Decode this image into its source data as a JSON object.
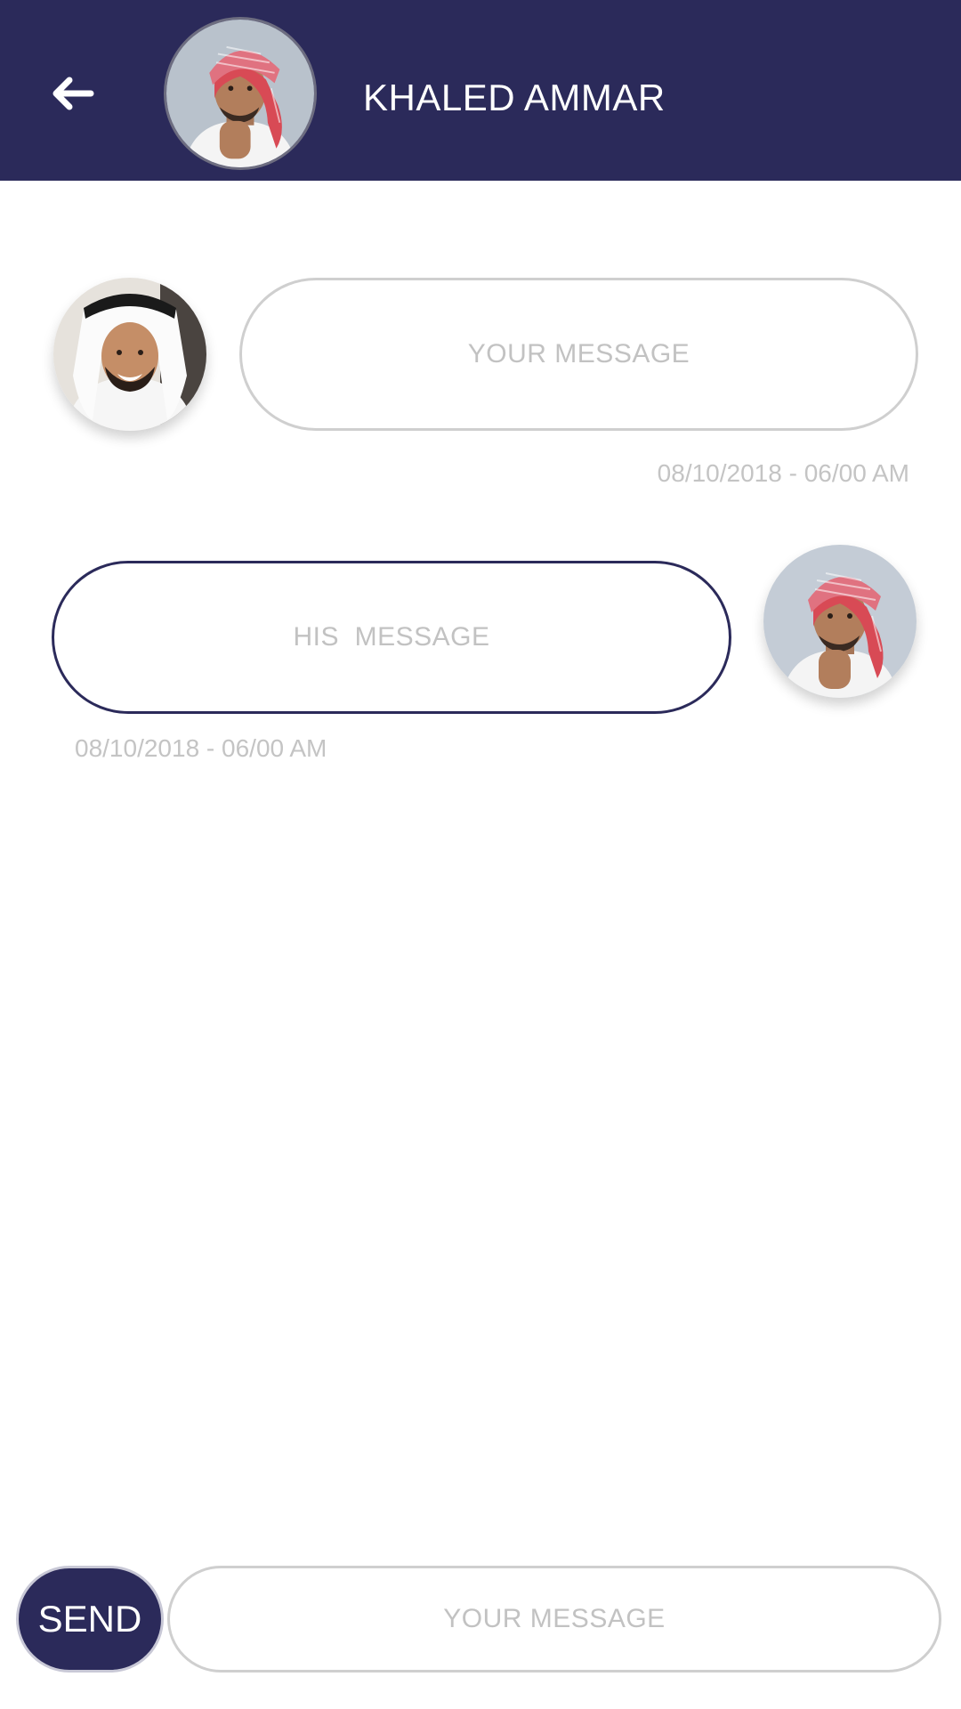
{
  "header": {
    "contact_name": "KHALED AMMAR",
    "back_icon": "arrow-left-icon",
    "background_color": "#2b2a5a"
  },
  "messages": [
    {
      "text": "YOUR MESSAGE",
      "timestamp": "08/10/2018 - 06/00 AM",
      "side": "left"
    },
    {
      "text": "HIS  MESSAGE",
      "timestamp": "08/10/2018 - 06/00 AM",
      "side": "right"
    }
  ],
  "composer": {
    "send_label": "SEND",
    "input_placeholder": "YOUR MESSAGE",
    "input_value": ""
  },
  "colors": {
    "accent": "#2b2a5a",
    "muted_text": "#c2c2c2",
    "bubble_border": "#cfcfcf"
  }
}
